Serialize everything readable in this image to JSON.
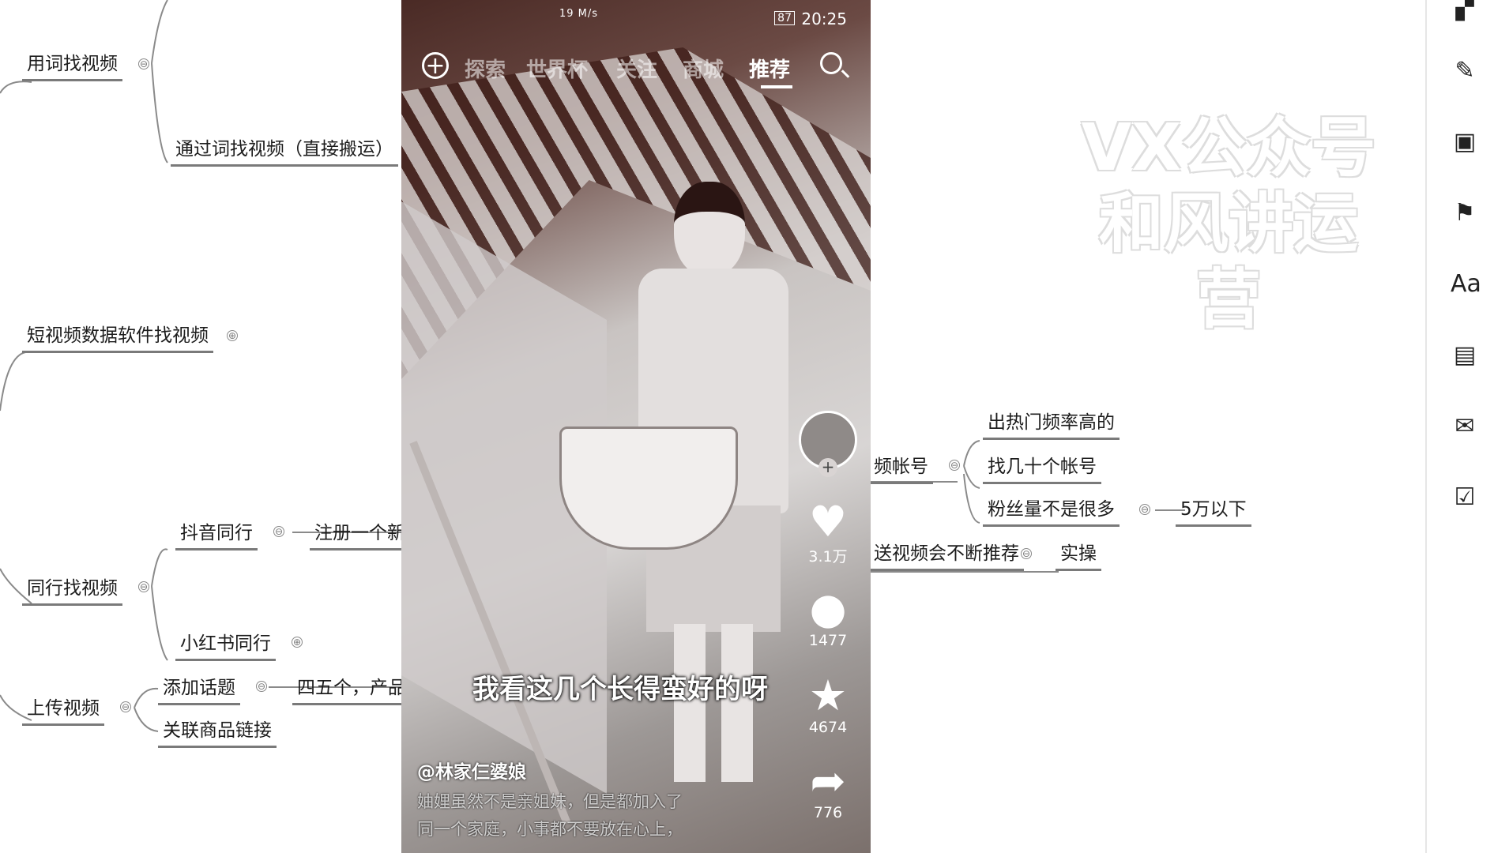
{
  "mindmap": {
    "left": {
      "word_find": "用词找视频",
      "word_find_sub": "通过词找视频（直接搬运）",
      "data_software": "短视频数据软件找视频",
      "peer_find": "同行找视频",
      "douyin_peer": "抖音同行",
      "douyin_peer_sub": "注册一个新",
      "xhs_peer": "小红书同行",
      "upload": "上传视频",
      "add_topic": "添加话题",
      "add_topic_sub": "四五个，产品",
      "link_product": "关联商品链接"
    },
    "right": {
      "account_node": "频帐号",
      "hot_rate": "出热门频率高的",
      "find_accounts": "找几十个帐号",
      "fans_not_many": "粉丝量不是很多",
      "under_50k": "5万以下",
      "keep_recommend": "送视频会不断推荐",
      "practice": "实操"
    },
    "toggles": {
      "collapse": "⊖",
      "expand": "⊕"
    }
  },
  "phone": {
    "status": {
      "time": "20:25",
      "battery": "87",
      "net_speed": "19 M/s"
    },
    "nav": {
      "plus_icon": "+",
      "tabs": [
        "探索",
        "世界杯",
        "关注",
        "商城",
        "推荐"
      ],
      "active_tab": "推荐"
    },
    "actions": {
      "like_count": "3.1万",
      "comment_count": "1477",
      "favorite_count": "4674",
      "share_count": "776"
    },
    "subtitle": "我看这几个长得蛮好的呀",
    "author": "@林家仨婆娘",
    "desc_line1": "妯娌虽然不是亲姐妹，但是都加入了",
    "desc_line2": "同一个家庭，小事都不要放在心上，"
  },
  "watermark": {
    "line1": "VX公众号",
    "line2": "和风讲运营"
  },
  "toolbar": {
    "icons": [
      "layout-icon",
      "brush-icon",
      "image-icon",
      "flag-icon",
      "text-style-icon",
      "note-icon",
      "comment-icon",
      "task-icon"
    ]
  }
}
